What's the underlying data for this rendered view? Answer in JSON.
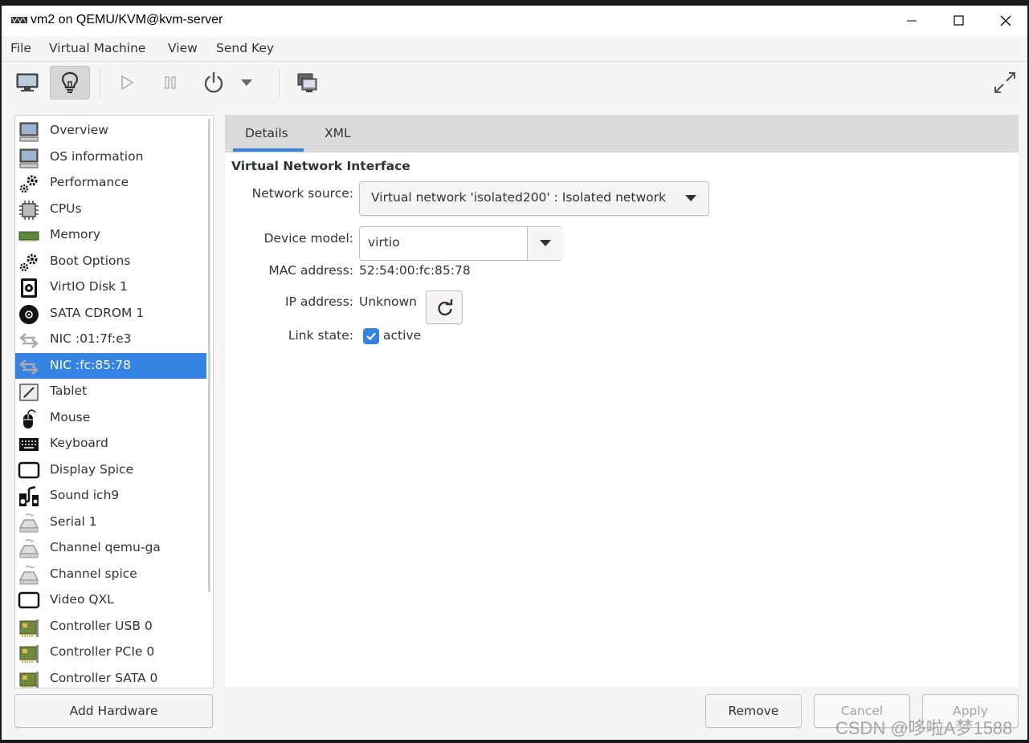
{
  "window": {
    "title": "vm2 on QEMU/KVM@kvm-server"
  },
  "menubar": [
    "File",
    "Virtual Machine",
    "View",
    "Send Key"
  ],
  "sidebar": {
    "selected_index": 9,
    "items": [
      {
        "label": "Overview",
        "icon": "monitor-icon"
      },
      {
        "label": "OS information",
        "icon": "monitor-icon"
      },
      {
        "label": "Performance",
        "icon": "gears-icon"
      },
      {
        "label": "CPUs",
        "icon": "chip-icon"
      },
      {
        "label": "Memory",
        "icon": "ram-icon"
      },
      {
        "label": "Boot Options",
        "icon": "gears-icon"
      },
      {
        "label": "VirtIO Disk 1",
        "icon": "disk-icon"
      },
      {
        "label": "SATA CDROM 1",
        "icon": "cdrom-icon"
      },
      {
        "label": "NIC :01:7f:e3",
        "icon": "nic-icon"
      },
      {
        "label": "NIC :fc:85:78",
        "icon": "nic-icon"
      },
      {
        "label": "Tablet",
        "icon": "tablet-icon"
      },
      {
        "label": "Mouse",
        "icon": "mouse-icon"
      },
      {
        "label": "Keyboard",
        "icon": "keyboard-icon"
      },
      {
        "label": "Display Spice",
        "icon": "display-icon"
      },
      {
        "label": "Sound ich9",
        "icon": "sound-icon"
      },
      {
        "label": "Serial 1",
        "icon": "serial-icon"
      },
      {
        "label": "Channel qemu-ga",
        "icon": "serial-icon"
      },
      {
        "label": "Channel spice",
        "icon": "serial-icon"
      },
      {
        "label": "Video QXL",
        "icon": "display-icon"
      },
      {
        "label": "Controller USB 0",
        "icon": "controller-icon"
      },
      {
        "label": "Controller PCIe 0",
        "icon": "controller-icon"
      },
      {
        "label": "Controller SATA 0",
        "icon": "controller-icon"
      }
    ]
  },
  "tabs": [
    "Details",
    "XML"
  ],
  "details": {
    "section_title": "Virtual Network Interface",
    "network_source_label": "Network source:",
    "network_source_value": "Virtual network 'isolated200' : Isolated network",
    "device_model_label": "Device model:",
    "device_model_value": "virtio",
    "mac_label": "MAC address:",
    "mac_value": "52:54:00:fc:85:78",
    "ip_label": "IP address:",
    "ip_value": "Unknown",
    "link_label": "Link state:",
    "link_value": "active",
    "link_checked": true
  },
  "buttons": {
    "add_hardware": "Add Hardware",
    "remove": "Remove",
    "cancel": "Cancel",
    "apply": "Apply"
  },
  "watermark": "CSDN @哆啦A梦1588",
  "colors": {
    "accent": "#3584e4",
    "selection_text": "#ffffff",
    "disabled_text": "#a2a4a3"
  }
}
